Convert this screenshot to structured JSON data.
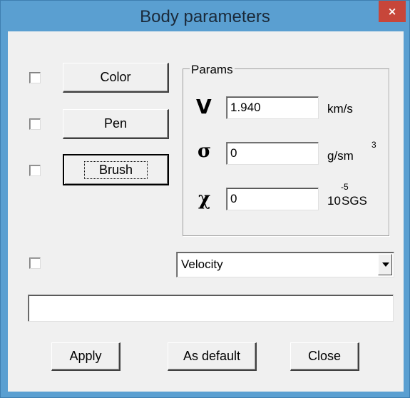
{
  "window": {
    "title": "Body parameters",
    "close_label": "×"
  },
  "buttons": {
    "color": "Color",
    "pen": "Pen",
    "brush": "Brush"
  },
  "params": {
    "group_label": "Params",
    "velocity": {
      "symbol": "V",
      "value": "1.940",
      "unit": "km/s"
    },
    "density": {
      "symbol": "σ",
      "value": "0",
      "unit": "g/sm",
      "unit_sup": "3"
    },
    "susceptibility": {
      "symbol": "χ",
      "value": "0",
      "unit_base": "10",
      "unit_sup": "-5",
      "unit_tail": "SGS"
    }
  },
  "property_select": {
    "selected": "Velocity"
  },
  "name_field": {
    "value": ""
  },
  "footer": {
    "apply": "Apply",
    "as_default": "As default",
    "close": "Close"
  },
  "colors": {
    "titlebar": "#5a9fd1",
    "close_button": "#c7463a",
    "dialog_bg": "#f0f0f0"
  }
}
